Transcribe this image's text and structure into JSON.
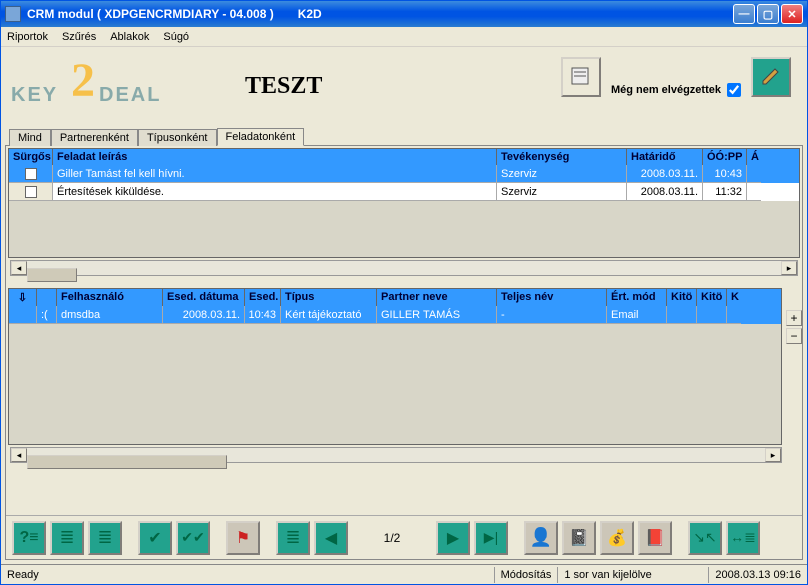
{
  "window": {
    "title": "CRM modul ( XDPGENCRMDIARY - 04.008 )",
    "subtitle": "K2D"
  },
  "menu": {
    "riportok": "Riportok",
    "szures": "Szűrés",
    "ablakok": "Ablakok",
    "sugo": "Súgó"
  },
  "header": {
    "logo_key": "KEY",
    "logo_deal": "DEAL",
    "logo_two": "2",
    "title": "TESZT",
    "filter_label": "Még nem elvégzettek"
  },
  "tabs": {
    "mind": "Mind",
    "partnerenkent": "Partnerenként",
    "tipusonkent": "Típusonként",
    "feladatonkent": "Feladatonként"
  },
  "top_grid": {
    "headers": {
      "surgos": "Sürgős",
      "feladat": "Feladat leírás",
      "tevekenyseg": "Tevékenység",
      "hatarido": "Határidő",
      "oopp": "ÓÓ:PP",
      "tail": "Á"
    },
    "rows": [
      {
        "feladat": "Giller Tamást fel kell hívni.",
        "tevekenyseg": "Szerviz",
        "hatarido": "2008.03.11.",
        "oopp": "10:43",
        "selected": true
      },
      {
        "feladat": "Értesítések kiküldése.",
        "tevekenyseg": "Szerviz",
        "hatarido": "2008.03.11.",
        "oopp": "11:32",
        "selected": false
      }
    ]
  },
  "bottom_grid": {
    "headers": {
      "c0": "",
      "face": "",
      "felhasznalo": "Felhasználó",
      "esed_datum": "Esed. dátuma",
      "esed": "Esed.",
      "tipus": "Típus",
      "partner": "Partner neve",
      "teljes": "Teljes név",
      "ert_mod": "Ért. mód",
      "kito": "Kitö",
      "kito2": "Kitö",
      "k": "K"
    },
    "row": {
      "face": ":(",
      "felhasznalo": "dmsdba",
      "esed_datum": "2008.03.11.",
      "esed": "10:43",
      "tipus": "Kért tájékoztató",
      "partner": "GILLER TAMÁS",
      "teljes": "-",
      "ert_mod": "Email"
    }
  },
  "toolbar": {
    "page": "1/2"
  },
  "status": {
    "ready": "Ready",
    "modositas": "Módosítás",
    "kijelolve": "1 sor van kijelölve",
    "datetime": "2008.03.13 09:16"
  }
}
